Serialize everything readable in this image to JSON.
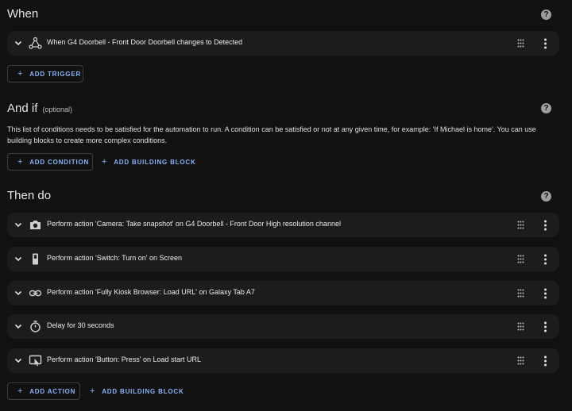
{
  "when": {
    "title": "When",
    "help": "?",
    "trigger": {
      "label": "When G4 Doorbell - Front Door Doorbell changes to Detected",
      "icon": "state-node-icon"
    },
    "add_trigger": "ADD TRIGGER",
    "plus": "+"
  },
  "andif": {
    "title": "And if",
    "optional": "(optional)",
    "help": "?",
    "description": "This list of conditions needs to be satisfied for the automation to run. A condition can be satisfied or not at any given time, for example: 'If Michael is home'. You can use building blocks to create more complex conditions.",
    "add_condition": "ADD CONDITION",
    "add_building_block": "ADD BUILDING BLOCK",
    "plus": "+"
  },
  "thendo": {
    "title": "Then do",
    "help": "?",
    "actions": [
      {
        "label": "Perform action 'Camera: Take snapshot' on G4 Doorbell - Front Door High resolution channel",
        "icon": "camera-icon"
      },
      {
        "label": "Perform action 'Switch: Turn on' on Screen",
        "icon": "switch-icon"
      },
      {
        "label": "Perform action 'Fully Kiosk Browser: Load URL' on Galaxy Tab A7",
        "icon": "link-icon"
      },
      {
        "label": "Delay for 30 seconds",
        "icon": "timer-icon"
      },
      {
        "label": "Perform action 'Button: Press' on Load start URL",
        "icon": "button-press-icon"
      }
    ],
    "add_action": "ADD ACTION",
    "add_building_block": "ADD BUILDING BLOCK",
    "plus": "+"
  }
}
